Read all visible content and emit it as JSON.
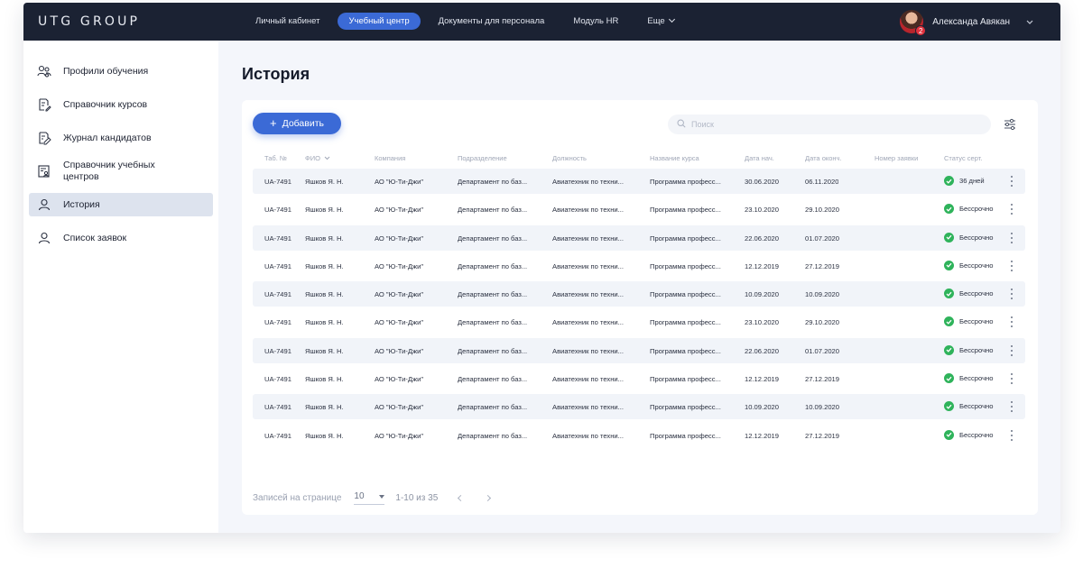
{
  "topbar": {
    "logo": "UTG GROUP",
    "nav": [
      "Личный кабинет",
      "Учебный центр",
      "Документы для персонала",
      "Модуль HR"
    ],
    "more_label": "Еще",
    "user_name": "Александа Авякан",
    "notifications": "2"
  },
  "sidebar": {
    "items": [
      {
        "label": "Профили обучения",
        "icon": "users-icon"
      },
      {
        "label": "Справочник курсов",
        "icon": "document-edit-icon"
      },
      {
        "label": "Журнал кандидатов",
        "icon": "journal-edit-icon"
      },
      {
        "label": "Справочник учебных центров",
        "icon": "id-card-icon"
      },
      {
        "label": "История",
        "icon": "user-icon"
      },
      {
        "label": "Список заявок",
        "icon": "user-icon"
      }
    ]
  },
  "main": {
    "title": "История",
    "add_label": "Добавить",
    "search_placeholder": "Поиск",
    "columns": [
      "Таб. №",
      "ФИО",
      "Компания",
      "Подразделение",
      "Должность",
      "Название курса",
      "Дата нач.",
      "Дата оконч.",
      "Номер заявки",
      "Статус серт."
    ],
    "rows": [
      {
        "tab": "UA-7491",
        "fio": "Яшков Я. Н.",
        "company": "АО \"Ю-Ти-Джи\"",
        "dept": "Департамент по баз...",
        "position": "Авиатехник по техни...",
        "course": "Программа професс...",
        "start": "30.06.2020",
        "end": "06.11.2020",
        "request": "",
        "status": "36 дней"
      },
      {
        "tab": "UA-7491",
        "fio": "Яшков Я. Н.",
        "company": "АО \"Ю-Ти-Джи\"",
        "dept": "Департамент по баз...",
        "position": "Авиатехник по техни...",
        "course": "Программа професс...",
        "start": "23.10.2020",
        "end": "29.10.2020",
        "request": "",
        "status": "Бессрочно"
      },
      {
        "tab": "UA-7491",
        "fio": "Яшков Я. Н.",
        "company": "АО \"Ю-Ти-Джи\"",
        "dept": "Департамент по баз...",
        "position": "Авиатехник по техни...",
        "course": "Программа професс...",
        "start": "22.06.2020",
        "end": "01.07.2020",
        "request": "",
        "status": "Бессрочно"
      },
      {
        "tab": "UA-7491",
        "fio": "Яшков Я. Н.",
        "company": "АО \"Ю-Ти-Джи\"",
        "dept": "Департамент по баз...",
        "position": "Авиатехник по техни...",
        "course": "Программа професс...",
        "start": "12.12.2019",
        "end": "27.12.2019",
        "request": "",
        "status": "Бессрочно"
      },
      {
        "tab": "UA-7491",
        "fio": "Яшков Я. Н.",
        "company": "АО \"Ю-Ти-Джи\"",
        "dept": "Департамент по баз...",
        "position": "Авиатехник по техни...",
        "course": "Программа професс...",
        "start": "10.09.2020",
        "end": "10.09.2020",
        "request": "",
        "status": "Бессрочно"
      },
      {
        "tab": "UA-7491",
        "fio": "Яшков Я. Н.",
        "company": "АО \"Ю-Ти-Джи\"",
        "dept": "Департамент по баз...",
        "position": "Авиатехник по техни...",
        "course": "Программа професс...",
        "start": "23.10.2020",
        "end": "29.10.2020",
        "request": "",
        "status": "Бессрочно"
      },
      {
        "tab": "UA-7491",
        "fio": "Яшков Я. Н.",
        "company": "АО \"Ю-Ти-Джи\"",
        "dept": "Департамент по баз...",
        "position": "Авиатехник по техни...",
        "course": "Программа професс...",
        "start": "22.06.2020",
        "end": "01.07.2020",
        "request": "",
        "status": "Бессрочно"
      },
      {
        "tab": "UA-7491",
        "fio": "Яшков Я. Н.",
        "company": "АО \"Ю-Ти-Джи\"",
        "dept": "Департамент по баз...",
        "position": "Авиатехник по техни...",
        "course": "Программа професс...",
        "start": "12.12.2019",
        "end": "27.12.2019",
        "request": "",
        "status": "Бессрочно"
      },
      {
        "tab": "UA-7491",
        "fio": "Яшков Я. Н.",
        "company": "АО \"Ю-Ти-Джи\"",
        "dept": "Департамент по баз...",
        "position": "Авиатехник по техни...",
        "course": "Программа професс...",
        "start": "10.09.2020",
        "end": "10.09.2020",
        "request": "",
        "status": "Бессрочно"
      },
      {
        "tab": "UA-7491",
        "fio": "Яшков Я. Н.",
        "company": "АО \"Ю-Ти-Джи\"",
        "dept": "Департамент по баз...",
        "position": "Авиатехник по техни...",
        "course": "Программа професс...",
        "start": "12.12.2019",
        "end": "27.12.2019",
        "request": "",
        "status": "Бессрочно"
      }
    ],
    "pagination": {
      "rows_per_page_label": "Записей на странице",
      "rows_per_page": "10",
      "range": "1-10 из 35"
    }
  },
  "colors": {
    "accent": "#3b6ad6",
    "topbar": "#1b2233",
    "status_ok": "#2fb35b"
  }
}
